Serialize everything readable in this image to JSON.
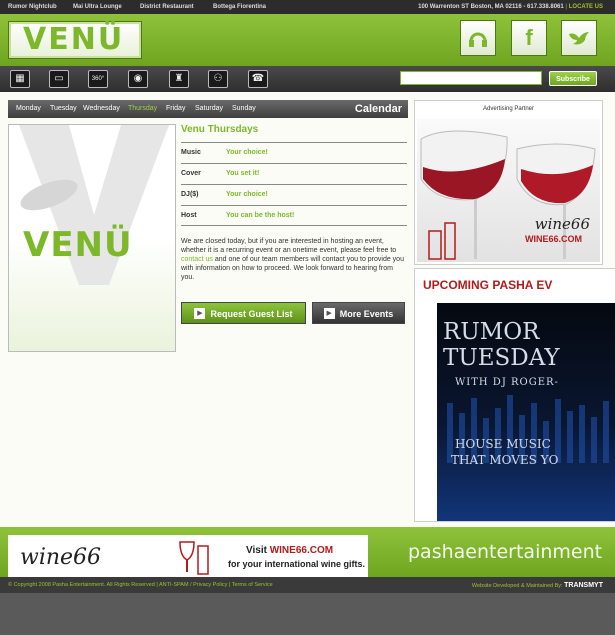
{
  "top_nav": {
    "links": [
      "Rumor Nightclub",
      "Mai Ultra Lounge",
      "District Restaurant",
      "Bottega Fiorentina"
    ],
    "address": "100 Warrenton ST Boston, MA 02116 - 617.338.8061",
    "locate": "LOCATE US"
  },
  "header": {
    "logo": "VENÜ",
    "social": [
      "headphones-icon",
      "facebook-icon",
      "twitter-bird-icon"
    ]
  },
  "icon_nav": {
    "icons": [
      "film-icon",
      "window-icon",
      "360-icon",
      "camera-icon",
      "tower-icon",
      "restroom-icon",
      "phone-icon"
    ],
    "icon_glyphs": [
      "▦",
      "▭",
      "360°",
      "◉",
      "♜",
      "⚇",
      "☎"
    ],
    "search_placeholder": "",
    "subscribe_label": "Subscribe"
  },
  "calendar": {
    "days": [
      "Monday",
      "Tuesday",
      "Wednesday",
      "Thursday",
      "Friday",
      "Saturday",
      "Sunday"
    ],
    "active_day": "Thursday",
    "title": "Calendar"
  },
  "event": {
    "image_logo": "VENÜ",
    "title": "Venu Thursdays",
    "details": [
      {
        "label": "Music",
        "value": "Your choice!"
      },
      {
        "label": "Cover",
        "value": "You set it!"
      },
      {
        "label": "DJ($)",
        "value": "Your choice!"
      },
      {
        "label": "Host",
        "value": "You can be the host!"
      }
    ],
    "desc_part1": "We are closed today, but if you are interested in hosting an event, whether it is a recurring event or an onetime event, please feel free to ",
    "desc_link": "contact us",
    "desc_part2": " and one of our team members will contact you to provide you with information on how to proceed. We look forward to hearing from you.",
    "guest_button": "Request Guest List",
    "more_button": "More Events"
  },
  "sidebar": {
    "ad_label": "Advertising Partner",
    "ad_logo": "wine66",
    "ad_url": "WINE66.COM",
    "upcoming_title": "UPCOMING PASHA EV",
    "poster_lines": [
      "RUMOR",
      "TUESDAY",
      "WITH DJ ROGER-",
      "HOUSE MUSIC",
      "THAT MOVES YO"
    ]
  },
  "footer": {
    "ad_logo": "wine66",
    "visit_text": "Visit ",
    "visit_url": "WINE66.COM",
    "ad_tagline": "for your international wine gifts.",
    "pasha": "pashaentertainment",
    "copyright": "© Copyright 2008 Pasha Entertainment. All Rights Reserved | ANTI-SPAM / Privacy Policy | Terms of Service",
    "dev_label": "Website Developed & Maintained By:",
    "dev_brand": "TRANSMYT"
  },
  "colors": {
    "accent_green": "#7cb82a",
    "header_green": "#8fc23b",
    "dark_gray": "#3a3a3a",
    "ad_red": "#b31b1b"
  }
}
